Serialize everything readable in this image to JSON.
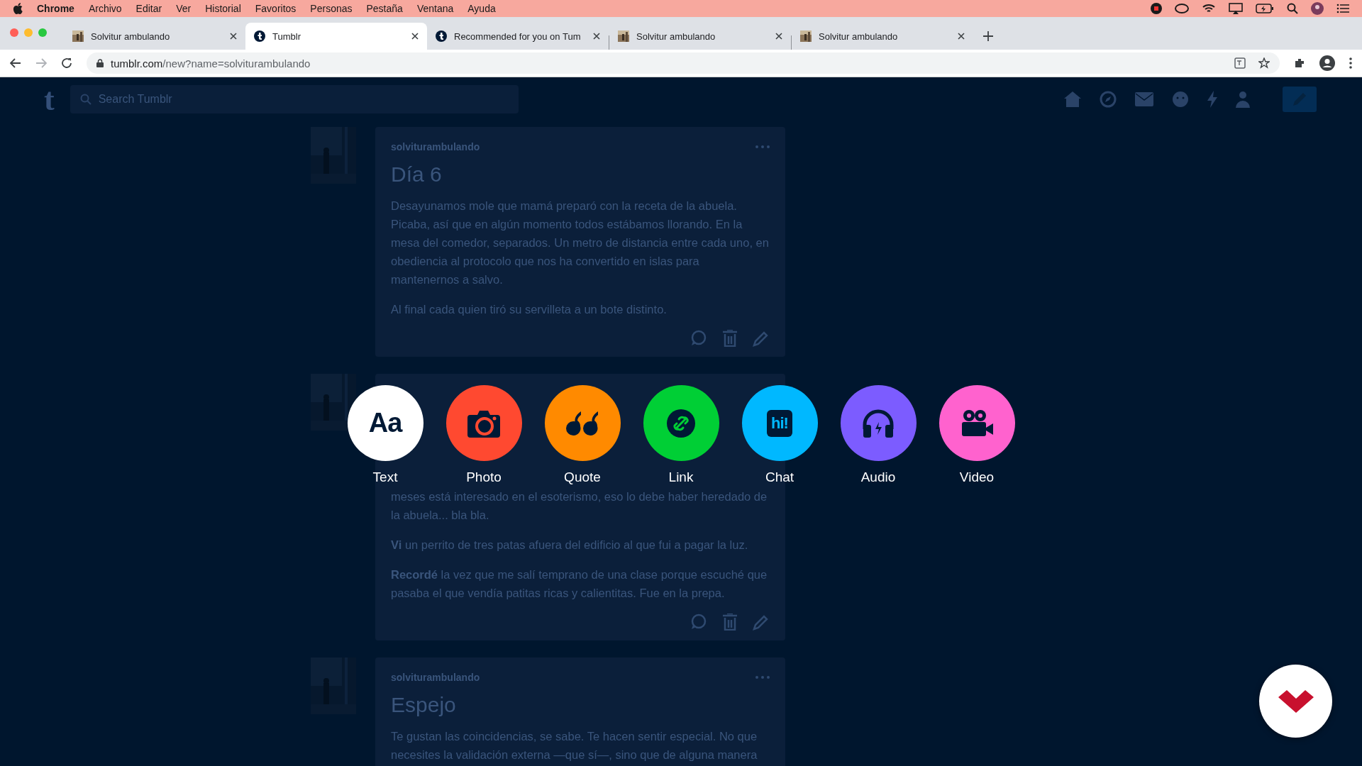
{
  "menu_bar": {
    "items": [
      {
        "label": "Chrome",
        "kind": "app"
      },
      {
        "label": "Archivo",
        "kind": "menu"
      },
      {
        "label": "Editar",
        "kind": "menu"
      },
      {
        "label": "Ver",
        "kind": "menu"
      },
      {
        "label": "Historial",
        "kind": "menu"
      },
      {
        "label": "Favoritos",
        "kind": "menu"
      },
      {
        "label": "Personas",
        "kind": "menu"
      },
      {
        "label": "Pestaña",
        "kind": "menu"
      },
      {
        "label": "Ventana",
        "kind": "menu"
      },
      {
        "label": "Ayuda",
        "kind": "menu"
      }
    ]
  },
  "tabs": [
    {
      "title": "Solvitur ambulando",
      "kind": "picture",
      "selected": false
    },
    {
      "title": "Tumblr",
      "kind": "site",
      "selected": true
    },
    {
      "title": "Recommended for you on Tum",
      "kind": "site",
      "selected": false
    },
    {
      "title": "Solvitur ambulando",
      "kind": "picture",
      "selected": false
    },
    {
      "title": "Solvitur ambulando",
      "kind": "picture",
      "selected": false
    }
  ],
  "address_bar": {
    "host": "tumblr.com",
    "path": "/new?name=solviturambulando"
  },
  "tumblr_header": {
    "logo": "t",
    "search": {
      "placeholder": "Search Tumblr"
    }
  },
  "posts": [
    {
      "username": "solviturambulando",
      "title": "Día 6",
      "show_actions": true,
      "paragraphs": [
        "Desayunamos mole que mamá preparó con la receta de la abuela. Picaba, así que en algún momento todos estábamos llorando. En la mesa del comedor, separados. Un metro de distancia entre cada uno, en obediencia al protocolo que nos ha convertido en islas para mantenernos a salvo.",
        "Al final cada quien tiró su servilleta a un bote distinto."
      ]
    },
    {
      "show_actions": true,
      "paragraphs": [
        "meses está interesado en el esoterismo, eso lo debe haber heredado de la abuela... bla bla.",
        "**Vi** un perrito de tres patas afuera del edificio al que fui a pagar la luz.",
        "**Recordé** la vez que me salí temprano de una clase porque escuché que pasaba el que vendía patitas ricas y calientitas. Fue en la prepa."
      ]
    },
    {
      "username": "solviturambulando",
      "title": "Espejo",
      "paragraphs": [
        "Te gustan las coincidencias, se sabe. Te hacen sentir especial. No que necesites la validación externa —que sí—, sino que de alguna manera"
      ]
    }
  ],
  "post_types": [
    {
      "kind": "text",
      "label": "Text",
      "glyph": "Aa",
      "color": "#ffffff"
    },
    {
      "label": "Photo",
      "color": "#ff4930"
    },
    {
      "kind": "quote",
      "label": "Quote",
      "color": "#ff8a00"
    },
    {
      "kind": "link",
      "label": "Link",
      "color": "#00cf35"
    },
    {
      "kind": "chat",
      "label": "Chat",
      "glyph": "hi!",
      "color": "#00b8ff"
    },
    {
      "kind": "audio",
      "label": "Audio",
      "color": "#7c5cff"
    },
    {
      "kind": "video",
      "label": "Video",
      "color": "#ff62ce"
    }
  ]
}
